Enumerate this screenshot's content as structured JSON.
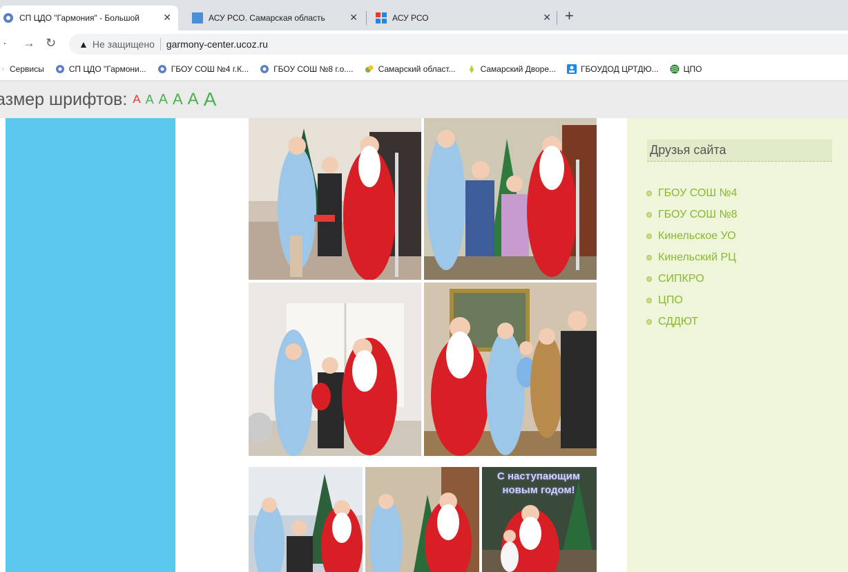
{
  "browser": {
    "tabs": [
      {
        "title": "СП ЦДО \"Гармония\" - Большой",
        "active": true
      },
      {
        "title": "АСУ РСО. Самарская область",
        "active": false
      },
      {
        "title": "АСУ РСО",
        "active": false
      }
    ],
    "close_glyph": "✕",
    "new_tab_glyph": "+",
    "security_label": "Не защищено",
    "url": "garmony-center.ucoz.ru",
    "bookmarks": [
      {
        "label": "Сервисы",
        "icon": "apps-icon"
      },
      {
        "label": "СП ЦДО \"Гармони...",
        "icon": "site-icon"
      },
      {
        "label": "ГБОУ СОШ №4 г.К...",
        "icon": "site-icon"
      },
      {
        "label": "ГБОУ СОШ №8 г.о....",
        "icon": "site-icon"
      },
      {
        "label": "Самарский област...",
        "icon": "leaf-icon"
      },
      {
        "label": "Самарский Дворе...",
        "icon": "leaf-icon"
      },
      {
        "label": "ГБОУДОД ЦРТДЮ...",
        "icon": "badge-icon"
      },
      {
        "label": "ЦПО",
        "icon": "globe-icon"
      }
    ]
  },
  "page": {
    "font_size_label": "азмер шрифтов:",
    "font_sizes": [
      "A",
      "A",
      "A",
      "A",
      "A",
      "A"
    ],
    "friends_title": "Друзья сайта",
    "friends_links": [
      "ГБОУ СОШ №4",
      "ГБОУ СОШ №8",
      "Кинельское УО",
      "Кинельский РЦ",
      "СИПКРО",
      "ЦПО",
      "СДДЮТ"
    ],
    "greeting_lines": [
      "С наступающим",
      "новым годом!"
    ]
  },
  "colors": {
    "left_panel": "#5bc8ee",
    "right_panel": "#eef5d8",
    "link": "#8ab834",
    "santa_red": "#d81f26",
    "snow_maiden_blue": "#9dc7e8"
  }
}
